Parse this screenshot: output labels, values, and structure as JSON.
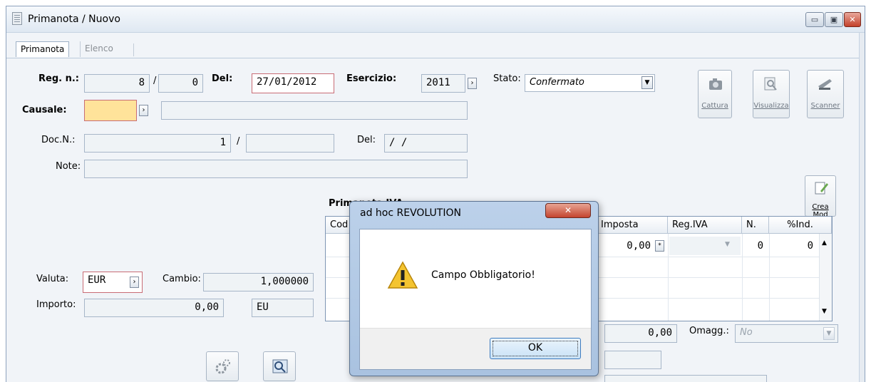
{
  "window": {
    "title": "Primanota / Nuovo",
    "min": "▭",
    "max": "▣",
    "close": "✕"
  },
  "tabs": [
    {
      "label": "Primanota"
    },
    {
      "label": "Elenco"
    }
  ],
  "form": {
    "reg_label": "Reg. n.:",
    "reg_value": "8",
    "reg_sep": "/",
    "reg_sub": "0",
    "del_label": "Del:",
    "del_value": "27/01/2012",
    "esercizio_label": "Esercizio:",
    "esercizio_value": "2011",
    "stato_label": "Stato:",
    "stato_value": "Confermato",
    "causale_label": "Causale:",
    "causale_value": "",
    "docn_label": "Doc.N.:",
    "docn_value": "1",
    "docn_sep": "/",
    "docn_extra": "",
    "docdel_label": "Del:",
    "docdel_value": " / /",
    "note_label": "Note:",
    "note_value": "",
    "valuta_label": "Valuta:",
    "valuta_value": "EUR",
    "cambio_label": "Cambio:",
    "cambio_value": "1,000000",
    "importo_label": "Importo:",
    "importo_value": "0,00",
    "importo_unit": "EU"
  },
  "toolbar": {
    "cattura": "Cattura",
    "visualizza": "Visualizza",
    "scanner": "Scanner",
    "crea_mod": "Crea Mod"
  },
  "iva": {
    "title": "Primanota IVA",
    "columns": [
      "Cod",
      "Imposta",
      "Reg.IVA",
      "N.",
      "%Ind."
    ],
    "row": {
      "imposta": "0,00",
      "n": "0",
      "ind": "0"
    },
    "total": "0,00",
    "omagg_label": "Omagg.:",
    "omagg_value": "No"
  },
  "dialog": {
    "title": "ad hoc REVOLUTION",
    "message": "Campo Obbligatorio!",
    "ok": "OK",
    "close": "✕"
  },
  "colors": {
    "required_border": "#c86c75",
    "required_fill": "#ffe39a",
    "title_bar": "#dfe8f2",
    "warning": "#f4c430"
  }
}
